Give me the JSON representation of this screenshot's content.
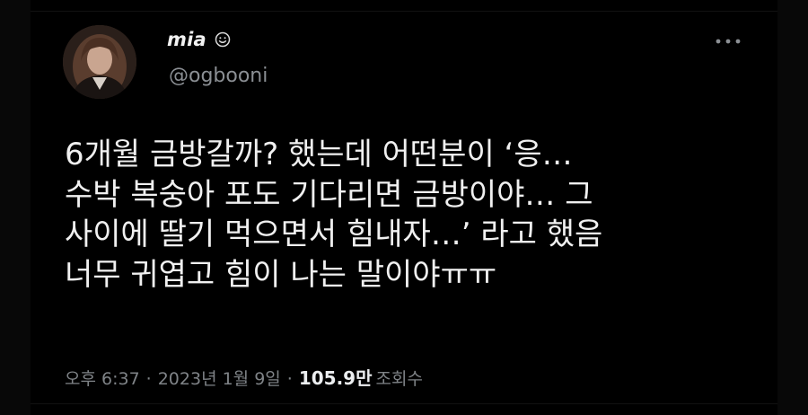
{
  "tweet": {
    "display_name": "mia",
    "handle": "@ogbooni",
    "name_emoji_icon": "smile-icon",
    "more_icon": "more-options-icon",
    "body_lines": [
      "6개월 금방갈까? 했는데 어떤분이 ‘응…",
      "수박 복숭아 포도 기다리면 금방이야… 그",
      "사이에 딸기 먹으면서 힘내자…’ 라고 했음",
      "너무 귀엽고 힘이 나는 말이야ㅠㅠ"
    ],
    "time": "오후 6:37",
    "separator": "·",
    "date": "2023년 1월 9일",
    "views_count": "105.9만",
    "views_label": "조회수"
  },
  "colors": {
    "background": "#000000",
    "text_primary": "#f0f0f0",
    "text_secondary": "#8b8f94"
  }
}
